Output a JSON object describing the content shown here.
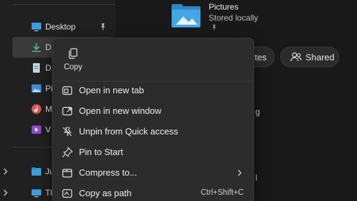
{
  "sidebar": {
    "items": [
      {
        "label": "Desktop",
        "icon": "desktop-icon",
        "pinned": true
      },
      {
        "label": "D",
        "icon": "downloads-icon",
        "selected": true
      },
      {
        "label": "D",
        "icon": "documents-icon"
      },
      {
        "label": "Pi",
        "icon": "pictures-icon"
      },
      {
        "label": "M",
        "icon": "music-icon"
      },
      {
        "label": "V",
        "icon": "videos-icon"
      },
      {
        "label": "Ju",
        "icon": "folder-icon"
      },
      {
        "label": "Tl",
        "icon": "drive-icon"
      }
    ]
  },
  "main": {
    "folder_title": "Pictures",
    "folder_subtitle": "Stored locally",
    "chip_tes": "tes",
    "chip_shared": "Shared",
    "partial_g": "g",
    "partial_l": "l"
  },
  "context_menu": {
    "copy_label": "Copy",
    "items": [
      {
        "label": "Open in new tab",
        "icon": "new-tab-icon"
      },
      {
        "label": "Open in new window",
        "icon": "new-window-icon"
      },
      {
        "label": "Unpin from Quick access",
        "icon": "unpin-icon"
      },
      {
        "label": "Pin to Start",
        "icon": "pin-icon"
      },
      {
        "label": "Compress to...",
        "icon": "compress-icon",
        "submenu": true
      },
      {
        "label": "Copy as path",
        "icon": "copy-path-icon",
        "shortcut": "Ctrl+Shift+C"
      }
    ]
  },
  "colors": {
    "accent": "#4cc2ff",
    "menu_bg": "#2c2c2c",
    "bg": "#191919"
  }
}
